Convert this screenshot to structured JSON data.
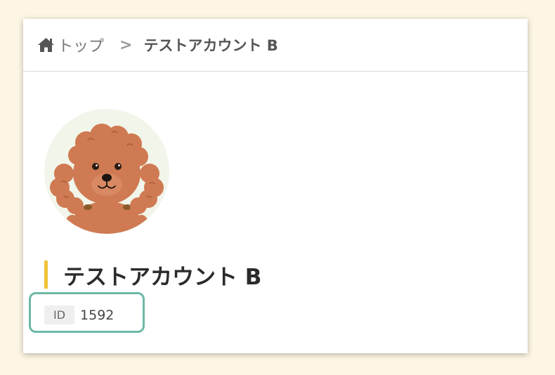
{
  "breadcrumb": {
    "home_label": "トップ",
    "separator": ">",
    "current": "テストアカウント B"
  },
  "profile": {
    "avatar_icon": "poodle-dog-avatar",
    "name": "テストアカウント B",
    "id_label": "ID",
    "id_value": "1592"
  },
  "colors": {
    "background": "#fdf6e4",
    "title_accent": "#f0c23b",
    "highlight_border": "#6cb9a6",
    "avatar_bg": "#f1f5ea"
  }
}
